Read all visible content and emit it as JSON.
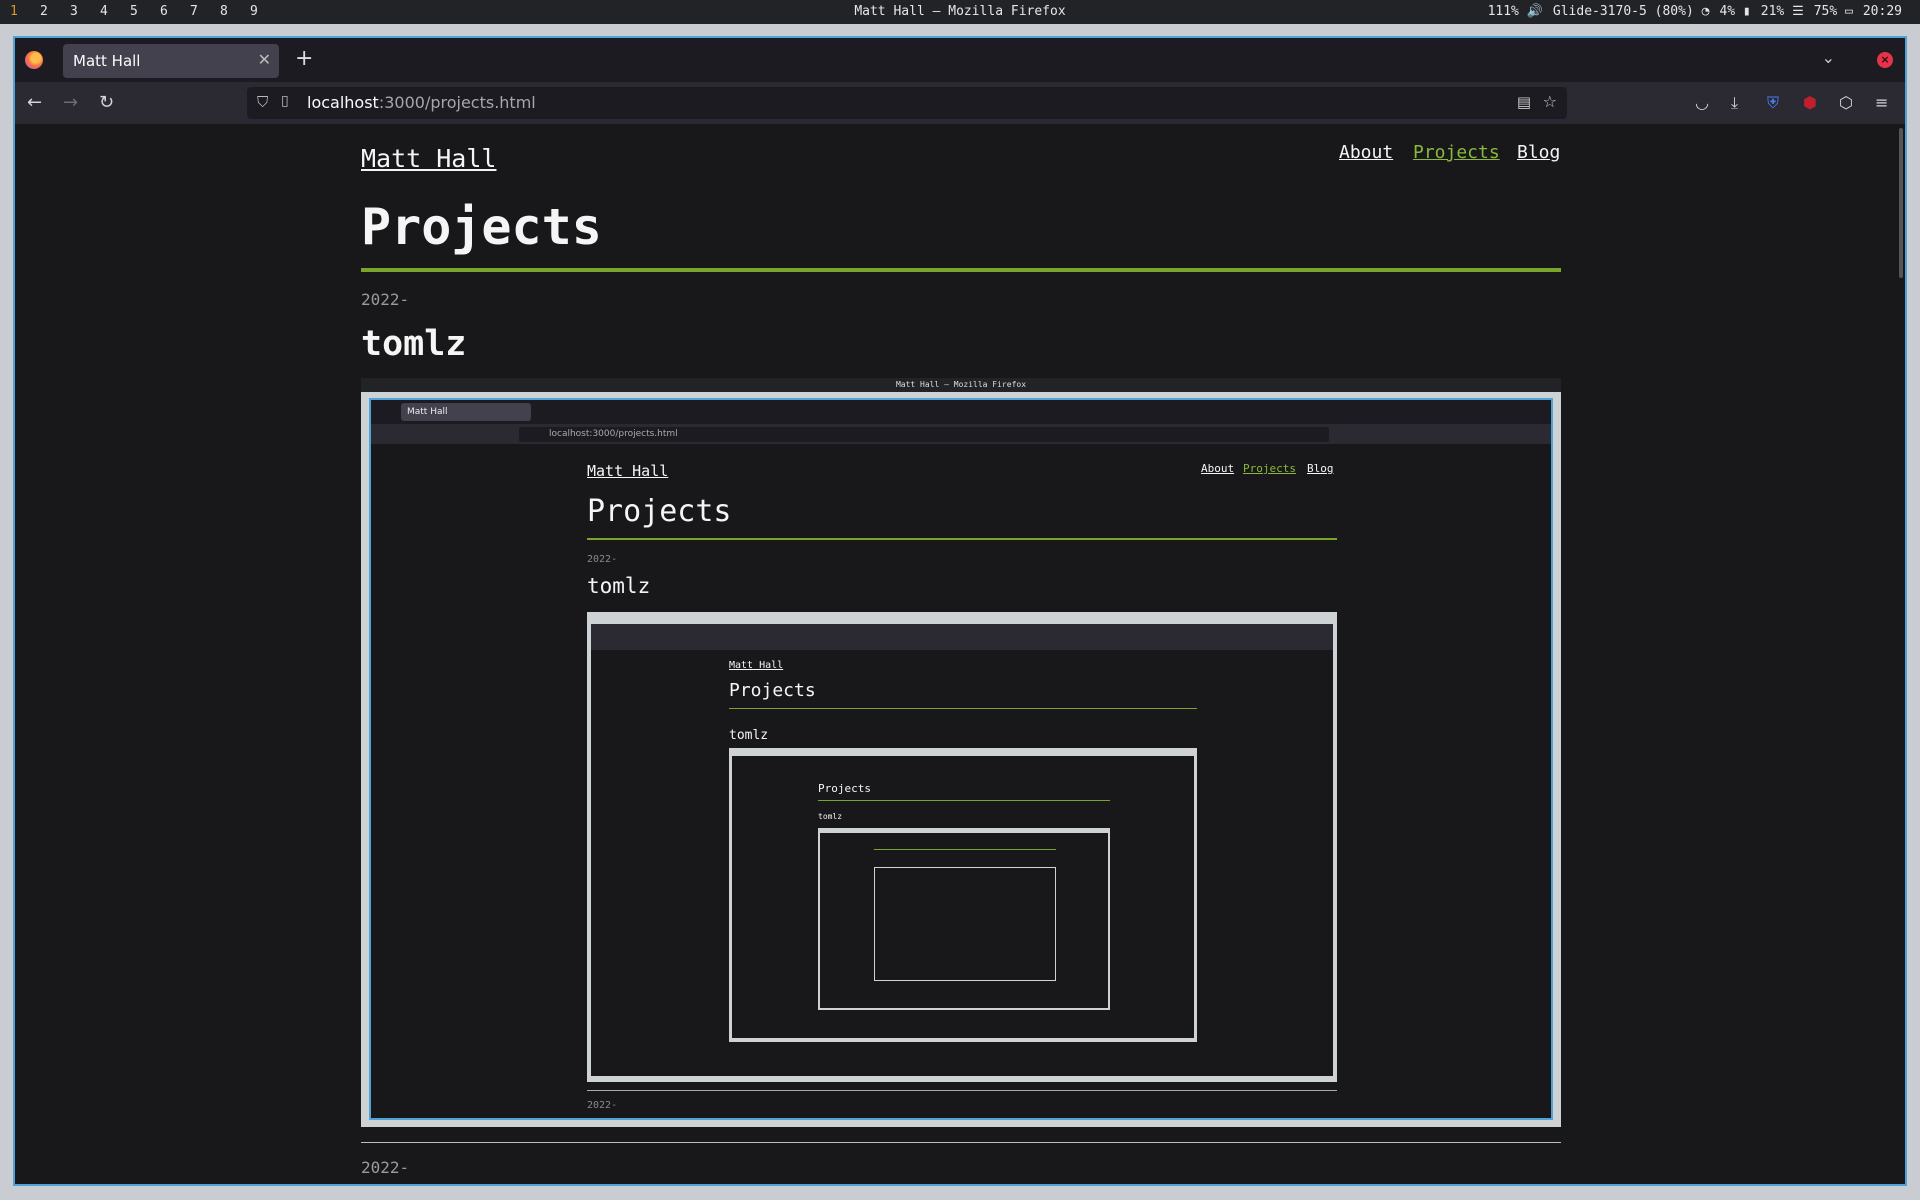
{
  "system_bar": {
    "workspaces": [
      "1",
      "2",
      "3",
      "4",
      "5",
      "6",
      "7",
      "8",
      "9"
    ],
    "active_workspace": "1",
    "window_title": "Matt Hall — Mozilla Firefox",
    "status": {
      "volume": "111% 🔊",
      "wifi": "Glide-3170-5 (80%)",
      "battery_small": "4%",
      "cpu": "21%",
      "battery": "75%",
      "time": "20:29"
    }
  },
  "browser": {
    "tab_title": "Matt Hall",
    "url_host": "localhost",
    "url_path": ":3000/projects.html",
    "accent": "#4fa3d9"
  },
  "site": {
    "title": "Matt Hall",
    "nav": [
      "About",
      "Projects",
      "Blog"
    ],
    "active_nav": "Projects",
    "heading": "Projects",
    "sections": [
      {
        "year": "2022-",
        "name": "tomlz"
      },
      {
        "year": "2022-"
      }
    ],
    "accent": "#7aa42b"
  }
}
